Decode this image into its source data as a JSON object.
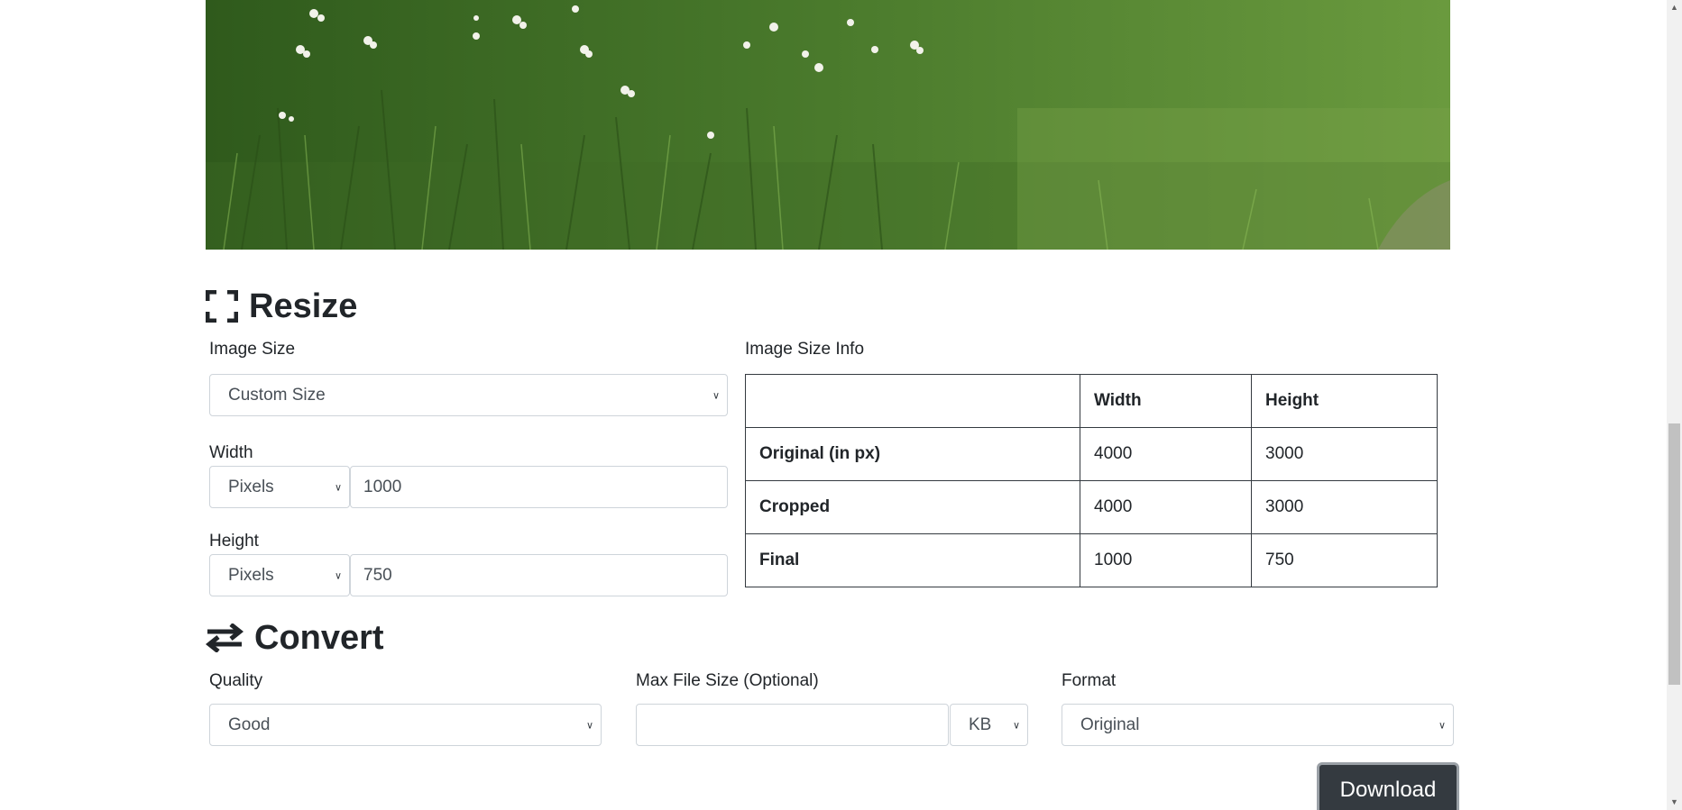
{
  "resize": {
    "title": "Resize",
    "image_size_label": "Image Size",
    "image_size_value": "Custom Size",
    "width_label": "Width",
    "width_unit": "Pixels",
    "width_value": "1000",
    "height_label": "Height",
    "height_unit": "Pixels",
    "height_value": "750",
    "info_label": "Image Size Info",
    "table": {
      "headers": [
        "",
        "Width",
        "Height"
      ],
      "rows": [
        {
          "label": "Original (in px)",
          "width": "4000",
          "height": "3000"
        },
        {
          "label": "Cropped",
          "width": "4000",
          "height": "3000"
        },
        {
          "label": "Final",
          "width": "1000",
          "height": "750"
        }
      ]
    }
  },
  "convert": {
    "title": "Convert",
    "quality_label": "Quality",
    "quality_value": "Good",
    "max_size_label": "Max File Size (Optional)",
    "max_size_value": "",
    "max_size_unit": "KB",
    "format_label": "Format",
    "format_value": "Original"
  },
  "download_label": "Download",
  "icons": {
    "resize": "fullscreen-corners-icon",
    "convert": "swap-arrows-icon",
    "select": "chevron-down-icon"
  },
  "colors": {
    "button_bg": "#343a40",
    "text": "#212529",
    "photo_green": "#4f7d2e"
  }
}
